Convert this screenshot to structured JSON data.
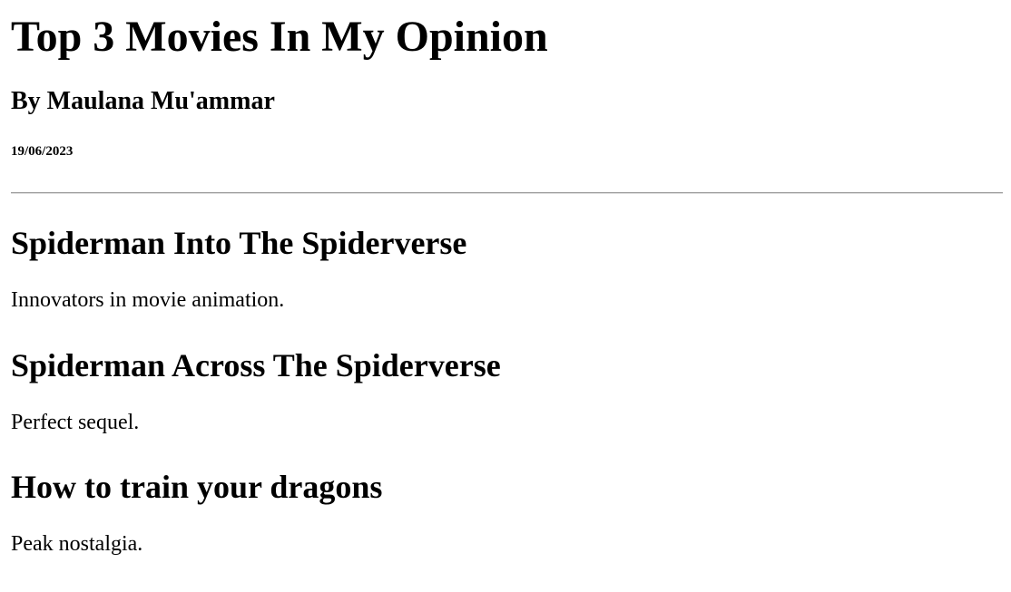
{
  "header": {
    "title": "Top 3 Movies In My Opinion",
    "author": "By Maulana Mu'ammar",
    "date": "19/06/2023"
  },
  "movies": [
    {
      "title": "Spiderman Into The Spiderverse",
      "description": "Innovators in movie animation."
    },
    {
      "title": "Spiderman Across The Spiderverse",
      "description": "Perfect sequel."
    },
    {
      "title": "How to train your dragons",
      "description": "Peak nostalgia."
    }
  ]
}
